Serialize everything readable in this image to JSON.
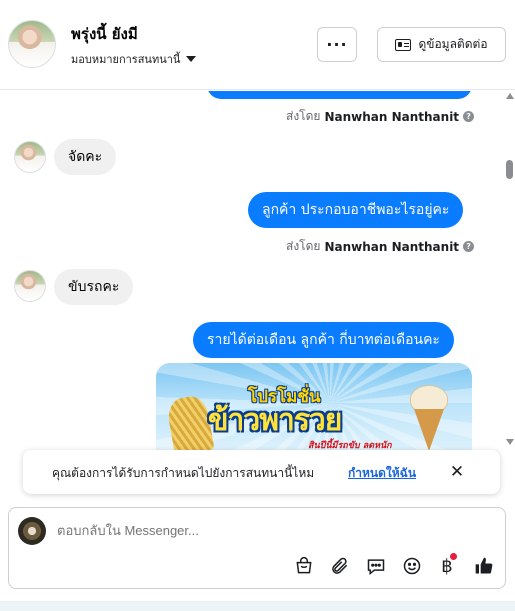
{
  "header": {
    "contact_name": "พรุ่งนี้ ยังมี",
    "assign_label": "มอบหมายการสนทนานี้",
    "more_label": "···",
    "contact_info_label": "ดูข้อมูลติดต่อ"
  },
  "messages": {
    "sent_prefix": "ส่งโดย",
    "sender_name": "Nanwhan Nanthanit",
    "info_mark": "?",
    "in_1": "จัดคะ",
    "out_1": "ลูกค้า ประกอบอาชีพอะไรอยู่คะ",
    "in_2": "ขับรถคะ",
    "out_2": "รายได้ต่อเดือน ลูกค้า  กี่บาทต่อเดือนคะ",
    "promo": {
      "line1": "โปรโมชั่น",
      "line2": "ข้าวพารวย",
      "line3": "สินปีนี้มีรถขับ ลดหนัก"
    }
  },
  "notice": {
    "text": "คุณต้องการได้รับการกำหนดไปยังการสนทนานี้ไหม",
    "link": "กำหนดให้ฉัน",
    "close": "✕"
  },
  "composer": {
    "placeholder": "ตอบกลับใน Messenger...",
    "baht_symbol": "฿",
    "icons": [
      "shopping-bag-icon",
      "paperclip-icon",
      "saved-reply-icon",
      "emoji-icon",
      "baht-payment-icon",
      "thumbs-up-icon"
    ]
  },
  "colors": {
    "outgoing_bubble": "#0a7cff",
    "incoming_bubble": "#f0f0f0",
    "link": "#1a66d8",
    "notification_dot": "#e41e3f"
  }
}
